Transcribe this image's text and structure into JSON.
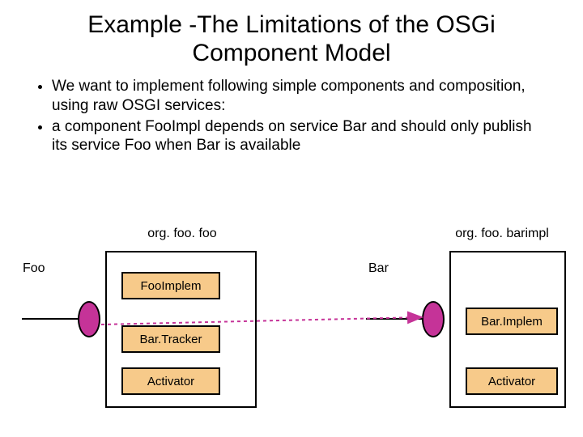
{
  "title": "Example -The Limitations of the OSGi Component Model",
  "bullets": {
    "b1": "We want to implement following simple components and composition, using raw OSGI services:",
    "b2": "a component FooImpl depends on service Bar and should only publish its service Foo when Bar is available"
  },
  "diagram": {
    "left_pkg": "org. foo. foo",
    "right_pkg": "org. foo. barimpl",
    "foo_label": "Foo",
    "bar_label": "Bar",
    "left_components": {
      "c1": "FooImplem",
      "c2": "Bar.Tracker",
      "c3": "Activator"
    },
    "right_components": {
      "c1": "Bar.Implem",
      "c2": "Activator"
    }
  }
}
